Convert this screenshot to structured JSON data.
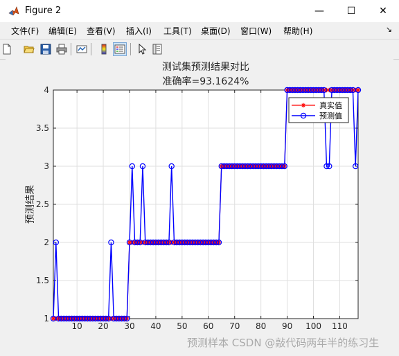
{
  "window": {
    "title": "Figure 2",
    "minimize": "—",
    "maximize": "☐",
    "close": "✕"
  },
  "menu": {
    "items": [
      "文件(F)",
      "编辑(E)",
      "查看(V)",
      "插入(I)",
      "工具(T)",
      "桌面(D)",
      "窗口(W)",
      "帮助(H)"
    ],
    "overflow_arrow": "↘"
  },
  "toolbar": {
    "icons": [
      "new-figure-icon",
      "open-file-icon",
      "save-icon",
      "print-icon",
      "link-plot-icon",
      "colorbar-icon",
      "legend-icon",
      "pointer-icon",
      "property-editor-icon"
    ]
  },
  "watermark": "预测样本 CSDN @敲代码两年半的练习生",
  "chart_data": {
    "type": "line",
    "title": "测试集预测结果对比",
    "subtitle": "准确率=93.1624%",
    "xlabel": "",
    "ylabel": "预测结果",
    "xlim": [
      1,
      117
    ],
    "ylim": [
      1,
      4
    ],
    "xticks": [
      10,
      20,
      30,
      40,
      50,
      60,
      70,
      80,
      90,
      100,
      110
    ],
    "yticks": [
      1,
      1.5,
      2,
      2.5,
      3,
      3.5,
      4
    ],
    "yticklabels": [
      "1",
      "1.5",
      "2",
      "2.5",
      "3",
      "3.5",
      "4"
    ],
    "grid": true,
    "legend_position": "top-right",
    "colors": {
      "true": "#ff0000",
      "pred": "#0000ff"
    },
    "x": [
      1,
      2,
      3,
      4,
      5,
      6,
      7,
      8,
      9,
      10,
      11,
      12,
      13,
      14,
      15,
      16,
      17,
      18,
      19,
      20,
      21,
      22,
      23,
      24,
      25,
      26,
      27,
      28,
      29,
      30,
      31,
      32,
      33,
      34,
      35,
      36,
      37,
      38,
      39,
      40,
      41,
      42,
      43,
      44,
      45,
      46,
      47,
      48,
      49,
      50,
      51,
      52,
      53,
      54,
      55,
      56,
      57,
      58,
      59,
      60,
      61,
      62,
      63,
      64,
      65,
      66,
      67,
      68,
      69,
      70,
      71,
      72,
      73,
      74,
      75,
      76,
      77,
      78,
      79,
      80,
      81,
      82,
      83,
      84,
      85,
      86,
      87,
      88,
      89,
      90,
      91,
      92,
      93,
      94,
      95,
      96,
      97,
      98,
      99,
      100,
      101,
      102,
      103,
      104,
      105,
      106,
      107,
      108,
      109,
      110,
      111,
      112,
      113,
      114,
      115,
      116,
      117
    ],
    "series": [
      {
        "name": "真实值",
        "marker": "star",
        "values": [
          1,
          1,
          1,
          1,
          1,
          1,
          1,
          1,
          1,
          1,
          1,
          1,
          1,
          1,
          1,
          1,
          1,
          1,
          1,
          1,
          1,
          1,
          1,
          1,
          1,
          1,
          1,
          1,
          1,
          2,
          2,
          2,
          2,
          2,
          2,
          2,
          2,
          2,
          2,
          2,
          2,
          2,
          2,
          2,
          2,
          2,
          2,
          2,
          2,
          2,
          2,
          2,
          2,
          2,
          2,
          2,
          2,
          2,
          2,
          2,
          2,
          2,
          2,
          2,
          3,
          3,
          3,
          3,
          3,
          3,
          3,
          3,
          3,
          3,
          3,
          3,
          3,
          3,
          3,
          3,
          3,
          3,
          3,
          3,
          3,
          3,
          3,
          3,
          3,
          4,
          4,
          4,
          4,
          4,
          4,
          4,
          4,
          4,
          4,
          4,
          4,
          4,
          4,
          4,
          4,
          4,
          4,
          4,
          4,
          4,
          4,
          4,
          4,
          4,
          4,
          4,
          4
        ]
      },
      {
        "name": "预测值",
        "marker": "circle",
        "values": [
          1,
          2,
          1,
          1,
          1,
          1,
          1,
          1,
          1,
          1,
          1,
          1,
          1,
          1,
          1,
          1,
          1,
          1,
          1,
          1,
          1,
          1,
          2,
          1,
          1,
          1,
          1,
          1,
          1,
          2,
          3,
          2,
          2,
          2,
          3,
          2,
          2,
          2,
          2,
          2,
          2,
          2,
          2,
          2,
          2,
          3,
          2,
          2,
          2,
          2,
          2,
          2,
          2,
          2,
          2,
          2,
          2,
          2,
          2,
          2,
          2,
          2,
          2,
          2,
          3,
          3,
          3,
          3,
          3,
          3,
          3,
          3,
          3,
          3,
          3,
          3,
          3,
          3,
          3,
          3,
          3,
          3,
          3,
          3,
          3,
          3,
          3,
          3,
          3,
          4,
          4,
          4,
          4,
          4,
          4,
          4,
          4,
          4,
          4,
          4,
          4,
          4,
          4,
          4,
          3,
          3,
          4,
          4,
          4,
          4,
          4,
          4,
          4,
          4,
          4,
          3,
          4
        ]
      }
    ]
  }
}
